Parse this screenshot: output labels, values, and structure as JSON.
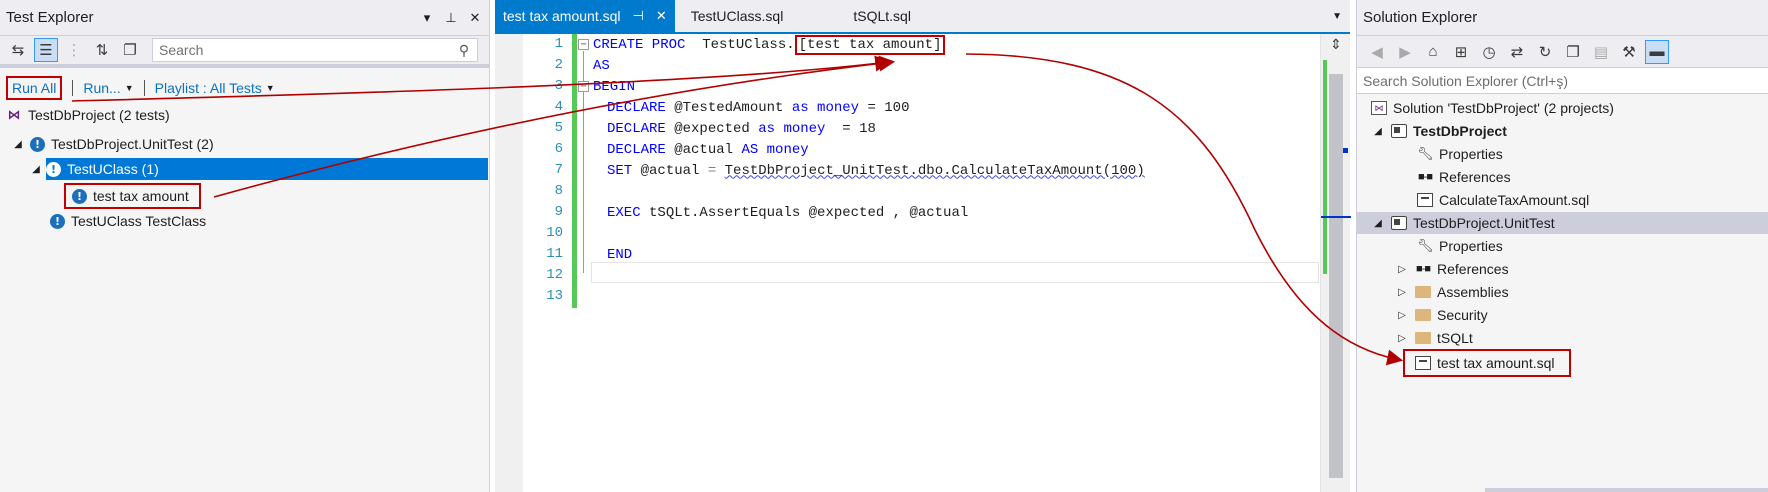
{
  "test_explorer": {
    "title": "Test Explorer",
    "search_placeholder": "Search",
    "run_all": "Run All",
    "run": "Run...",
    "playlist": "Playlist : All Tests",
    "tree": [
      {
        "label": "TestDbProject (2 tests)"
      },
      {
        "label": "TestDbProject.UnitTest (2)"
      },
      {
        "label": "TestUClass (1)"
      },
      {
        "label": "test tax amount"
      },
      {
        "label": "TestUClass TestClass"
      }
    ]
  },
  "editor": {
    "tabs": [
      {
        "label": "test tax amount.sql"
      },
      {
        "label": "TestUClass.sql"
      },
      {
        "label": "tSQLt.sql"
      }
    ],
    "line_numbers": [
      "1",
      "2",
      "3",
      "4",
      "5",
      "6",
      "7",
      "8",
      "9",
      "10",
      "11",
      "12",
      "13"
    ],
    "code": {
      "l1_kw": "CREATE PROC",
      "l1_schema": "  TestUClass.",
      "l1_name": "[test tax amount]",
      "l2": "AS",
      "l3": "BEGIN",
      "l4_kw": "DECLARE",
      "l4_var": " @TestedAmount ",
      "l4_as": "as",
      "l4_type": " money",
      "l4_rest": " = 100",
      "l5_kw": "DECLARE",
      "l5_var": " @expected ",
      "l5_as": "as",
      "l5_type": " money",
      "l5_rest": "  = 18",
      "l6_kw": "DECLARE",
      "l6_var": " @actual ",
      "l6_as": "AS",
      "l6_type": " money",
      "l7_kw": "SET",
      "l7_var": " @actual ",
      "l7_eq": "= ",
      "l7_call": "TestDbProject_UnitTest.dbo.CalculateTaxAmount(100)",
      "l9_kw": "EXEC",
      "l9_rest": " tSQLt.AssertEquals @expected , @actual",
      "l11": "END"
    }
  },
  "solution_explorer": {
    "title": "Solution Explorer",
    "search_placeholder": "Search Solution Explorer (Ctrl+ş)",
    "items": [
      {
        "label": "Solution 'TestDbProject' (2 projects)"
      },
      {
        "label": "TestDbProject"
      },
      {
        "label": "Properties"
      },
      {
        "label": "References"
      },
      {
        "label": "CalculateTaxAmount.sql"
      },
      {
        "label": "TestDbProject.UnitTest"
      },
      {
        "label": "Properties"
      },
      {
        "label": "References"
      },
      {
        "label": "Assemblies"
      },
      {
        "label": "Security"
      },
      {
        "label": "tSQLt"
      },
      {
        "label": "test tax amount.sql"
      }
    ]
  },
  "colors": {
    "accent": "#007acc",
    "selection": "#0078d7",
    "highlight_box": "#c00000",
    "keyword": "#0000ff"
  },
  "icons": {
    "test_status": "warning-info-icon",
    "project": "vs-project-icon",
    "folder": "folder-icon",
    "sql_file": "sql-file-icon"
  }
}
